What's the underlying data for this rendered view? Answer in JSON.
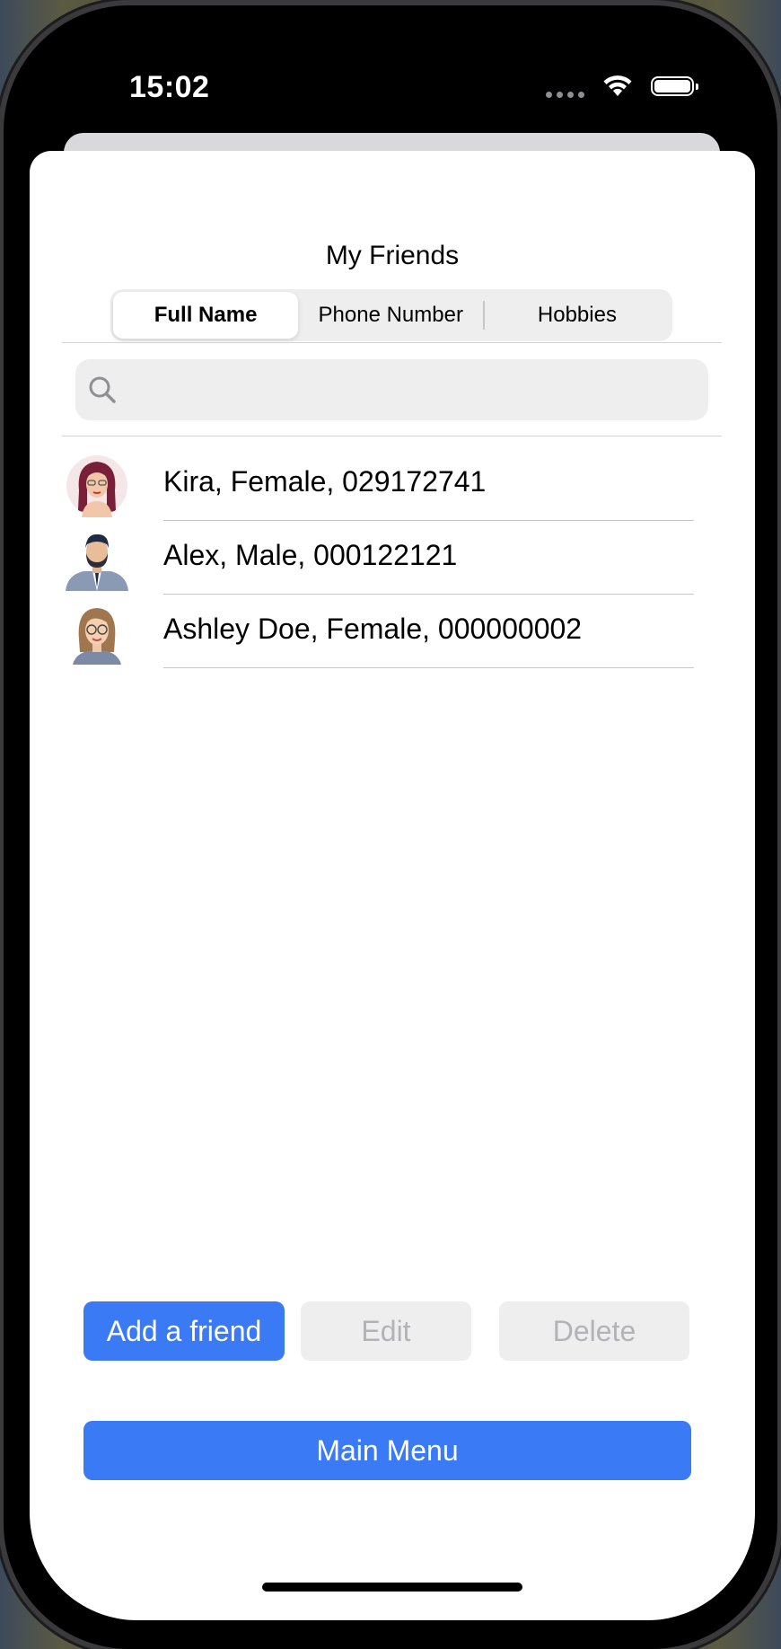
{
  "status_bar": {
    "time": "15:02"
  },
  "screen": {
    "title": "My Friends"
  },
  "segments": [
    {
      "label": "Full Name",
      "selected": true
    },
    {
      "label": "Phone Number",
      "selected": false
    },
    {
      "label": "Hobbies",
      "selected": false
    }
  ],
  "search": {
    "placeholder": "",
    "value": ""
  },
  "friends": [
    {
      "text": "Kira, Female, 029172741",
      "avatar": "woman-red-hair-glasses-avatar"
    },
    {
      "text": "Alex, Male, 000122121",
      "avatar": "man-beard-suit-avatar"
    },
    {
      "text": "Ashley Doe, Female, 000000002",
      "avatar": "woman-brown-hair-glasses-avatar"
    }
  ],
  "actions": {
    "add_label": "Add a friend",
    "edit_label": "Edit",
    "delete_label": "Delete",
    "main_menu_label": "Main Menu"
  },
  "colors": {
    "accent": "#3a7af5",
    "disabled_bg": "#eeeeef",
    "disabled_text": "#b3b3b7"
  }
}
